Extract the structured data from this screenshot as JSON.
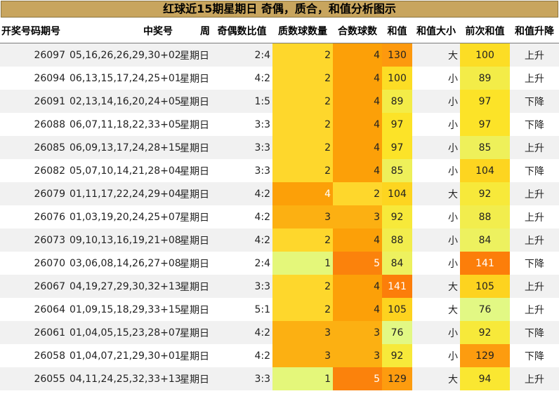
{
  "title": "红球近15期星期日 奇偶，质合，和值分析图示",
  "headers": [
    "开奖号码期号",
    "中奖号",
    "周",
    "奇偶数比值",
    "质数球数量",
    "合数球数",
    "和值",
    "和值大小",
    "前次和值",
    "和值升降"
  ],
  "rows": [
    {
      "issue": "26097",
      "numbers": "05,16,26,26,29,30+02",
      "weekday": "星期日",
      "odd_even": "2:4",
      "prime": 2,
      "composite": 4,
      "sum": 130,
      "size": "大",
      "prev_sum": 100,
      "trend": "上升"
    },
    {
      "issue": "26094",
      "numbers": "06,13,15,17,24,25+01",
      "weekday": "星期日",
      "odd_even": "4:2",
      "prime": 2,
      "composite": 4,
      "sum": 100,
      "size": "小",
      "prev_sum": 89,
      "trend": "上升"
    },
    {
      "issue": "26091",
      "numbers": "02,13,14,16,20,24+05",
      "weekday": "星期日",
      "odd_even": "1:5",
      "prime": 2,
      "composite": 4,
      "sum": 89,
      "size": "小",
      "prev_sum": 97,
      "trend": "下降"
    },
    {
      "issue": "26088",
      "numbers": "06,07,11,18,22,33+05",
      "weekday": "星期日",
      "odd_even": "3:3",
      "prime": 2,
      "composite": 4,
      "sum": 97,
      "size": "小",
      "prev_sum": 97,
      "trend": "下降"
    },
    {
      "issue": "26085",
      "numbers": "06,09,13,17,24,28+15",
      "weekday": "星期日",
      "odd_even": "3:3",
      "prime": 2,
      "composite": 4,
      "sum": 97,
      "size": "小",
      "prev_sum": 85,
      "trend": "上升"
    },
    {
      "issue": "26082",
      "numbers": "05,07,10,14,21,28+04",
      "weekday": "星期日",
      "odd_even": "3:3",
      "prime": 2,
      "composite": 4,
      "sum": 85,
      "size": "小",
      "prev_sum": 104,
      "trend": "下降"
    },
    {
      "issue": "26079",
      "numbers": "01,11,17,22,24,29+04",
      "weekday": "星期日",
      "odd_even": "4:2",
      "prime": 4,
      "composite": 2,
      "sum": 104,
      "size": "大",
      "prev_sum": 92,
      "trend": "上升"
    },
    {
      "issue": "26076",
      "numbers": "01,03,19,20,24,25+07",
      "weekday": "星期日",
      "odd_even": "4:2",
      "prime": 3,
      "composite": 3,
      "sum": 92,
      "size": "小",
      "prev_sum": 88,
      "trend": "上升"
    },
    {
      "issue": "26073",
      "numbers": "09,10,13,16,19,21+08",
      "weekday": "星期日",
      "odd_even": "4:2",
      "prime": 2,
      "composite": 4,
      "sum": 88,
      "size": "小",
      "prev_sum": 84,
      "trend": "上升"
    },
    {
      "issue": "26070",
      "numbers": "03,06,08,14,26,27+08",
      "weekday": "星期日",
      "odd_even": "2:4",
      "prime": 1,
      "composite": 5,
      "sum": 84,
      "size": "小",
      "prev_sum": 141,
      "trend": "下降"
    },
    {
      "issue": "26067",
      "numbers": "04,19,27,29,30,32+13",
      "weekday": "星期日",
      "odd_even": "3:3",
      "prime": 2,
      "composite": 4,
      "sum": 141,
      "size": "大",
      "prev_sum": 105,
      "trend": "上升"
    },
    {
      "issue": "26064",
      "numbers": "01,09,15,18,29,33+15",
      "weekday": "星期日",
      "odd_even": "5:1",
      "prime": 2,
      "composite": 4,
      "sum": 105,
      "size": "大",
      "prev_sum": 76,
      "trend": "上升"
    },
    {
      "issue": "26061",
      "numbers": "01,04,05,15,23,28+07",
      "weekday": "星期日",
      "odd_even": "4:2",
      "prime": 3,
      "composite": 3,
      "sum": 76,
      "size": "小",
      "prev_sum": 92,
      "trend": "下降"
    },
    {
      "issue": "26058",
      "numbers": "01,04,07,21,29,30+01",
      "weekday": "星期日",
      "odd_even": "4:2",
      "prime": 3,
      "composite": 3,
      "sum": 92,
      "size": "小",
      "prev_sum": 129,
      "trend": "下降"
    },
    {
      "issue": "26055",
      "numbers": "04,11,24,25,32,33+13",
      "weekday": "星期日",
      "odd_even": "3:3",
      "prime": 1,
      "composite": 5,
      "sum": 129,
      "size": "大",
      "prev_sum": 94,
      "trend": "上升"
    }
  ]
}
